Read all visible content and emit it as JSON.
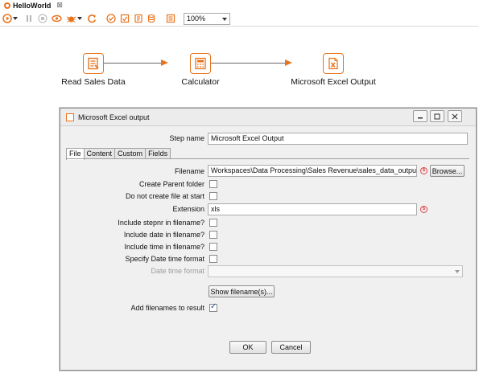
{
  "tab": {
    "title": "HelloWorld",
    "close": "⊠"
  },
  "toolbar": {
    "zoom": "100%"
  },
  "steps": [
    {
      "label": "Read Sales Data",
      "icon": "text-input-icon"
    },
    {
      "label": "Calculator",
      "icon": "calculator-icon"
    },
    {
      "label": "Microsoft Excel Output",
      "icon": "excel-output-icon"
    }
  ],
  "dialog": {
    "title": "Microsoft Excel output",
    "step_name_label": "Step name",
    "step_name_value": "Microsoft Excel Output",
    "tabs": [
      "File",
      "Content",
      "Custom",
      "Fields"
    ],
    "filename_label": "Filename",
    "filename_value": "Workspaces\\Data Processing\\Sales Revenue\\sales_data_output",
    "browse_label": "Browse...",
    "create_parent_folder_label": "Create Parent folder",
    "create_parent_folder_checked": false,
    "do_not_create_label": "Do not create file at start",
    "do_not_create_checked": false,
    "extension_label": "Extension",
    "extension_value": "xls",
    "include_stepnr_label": "Include stepnr in filename?",
    "include_stepnr_checked": false,
    "include_date_label": "Include date in filename?",
    "include_date_checked": false,
    "include_time_label": "Include time in filename?",
    "include_time_checked": false,
    "specify_date_time_label": "Specify Date time format",
    "specify_date_time_checked": false,
    "date_time_format_label": "Date time format",
    "date_time_format_value": "",
    "show_filenames_label": "Show filename(s)...",
    "add_filenames_label": "Add filenames to result",
    "add_filenames_checked": true,
    "ok_label": "OK",
    "cancel_label": "Cancel",
    "variable_icon_glyph": "$"
  },
  "colors": {
    "accent": "#e8741e",
    "hop_line": "#666666",
    "checkmark": "#2a4f9c"
  }
}
